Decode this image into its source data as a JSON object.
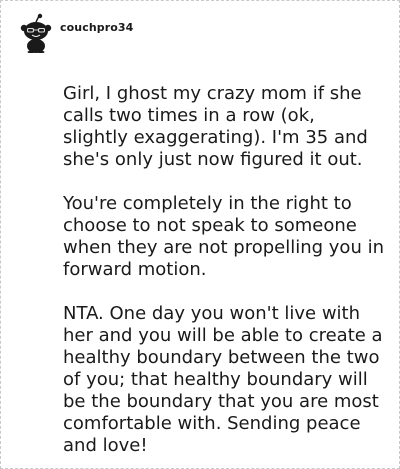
{
  "comment": {
    "username": "couchpro34",
    "avatar_icon": "snoo-avatar-icon",
    "paragraphs": [
      "Girl, I ghost my crazy mom if she calls two times in a row (ok, slightly exaggerating). I'm 35 and she's only just now figured it out.",
      "You're completely in the right to choose to not speak to someone when they are not propelling you in forward motion.",
      "NTA. One day you won't live with her and you will be able to create a healthy boundary between the two of you; that healthy boundary will be the boundary that you are most comfortable with. Sending peace and love!"
    ]
  },
  "colors": {
    "text": "#1a1a1b",
    "border": "#c9c9c9",
    "background": "#ffffff"
  }
}
